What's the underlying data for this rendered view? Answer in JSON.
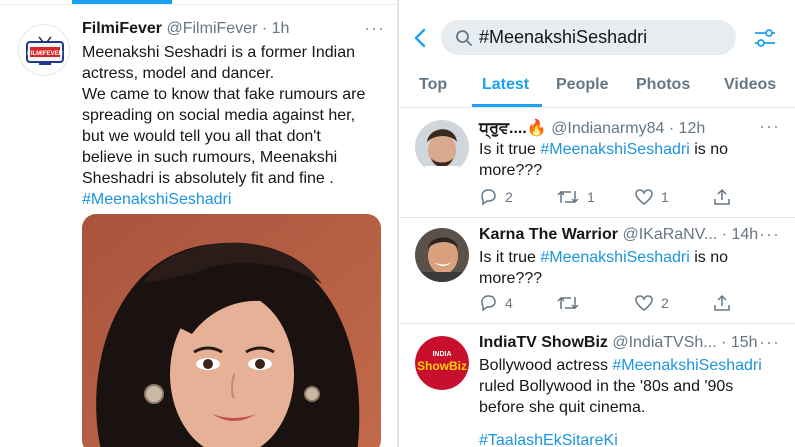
{
  "left_tweet": {
    "author_name": "FilmiFever",
    "author_handle": "@FilmiFever",
    "time": "· 1h",
    "more": "···",
    "logo_text": "FILMIFEVER",
    "lines": [
      "Meenakshi Seshadri  is a former Indian",
      "actress, model and dancer.",
      "We came to know that fake rumours are",
      "spreading on social media against her,",
      "but we would tell you all that don't",
      "believe in such rumours, Meenakshi",
      "Sheshadri is absolutely fit and fine ."
    ],
    "hashtag": "#MeenakshiSeshadri"
  },
  "search": {
    "query": "#MeenakshiSeshadri"
  },
  "tabs": [
    "Top",
    "Latest",
    "People",
    "Photos",
    "Videos"
  ],
  "active_tab": "Latest",
  "tweets": [
    {
      "name": "ਧ੍ਰੁਵ....🔥",
      "handle": "@Indianarmy84",
      "time": "· 12h",
      "more": "···",
      "text_before": "Is it true ",
      "hashtag": "#MeenakshiSeshadri",
      "text_after": " is no",
      "line2": "more???",
      "replies": "2",
      "retweets": "1",
      "likes": "1"
    },
    {
      "name": "Karna The Warrior",
      "handle": "@IKaRaNV...",
      "time": "· 14h",
      "more": "···",
      "text_before": "Is it true ",
      "hashtag": "#MeenakshiSeshadri",
      "text_after": " is no",
      "line2": "more???",
      "replies": "4",
      "retweets": "",
      "likes": "2"
    },
    {
      "name": "IndiaTV ShowBiz",
      "handle": "@IndiaTVSh...",
      "time": "· 15h",
      "more": "···",
      "text_before": "Bollywood actress ",
      "hashtag": "#MeenakshiSeshadri",
      "line2": "ruled Bollywood in the '80s and '90s",
      "line3": "before she quit cinema.",
      "hashtag2": "#TaalashEkSitareKi",
      "logo_text_top": "INDIA",
      "logo_text_bottom": "ShowBiz"
    }
  ],
  "colors": {
    "accent": "#1da1f2",
    "hashtag": "#1b95e0",
    "secondary_text": "#657786",
    "search_bg": "#e6ecf0"
  }
}
